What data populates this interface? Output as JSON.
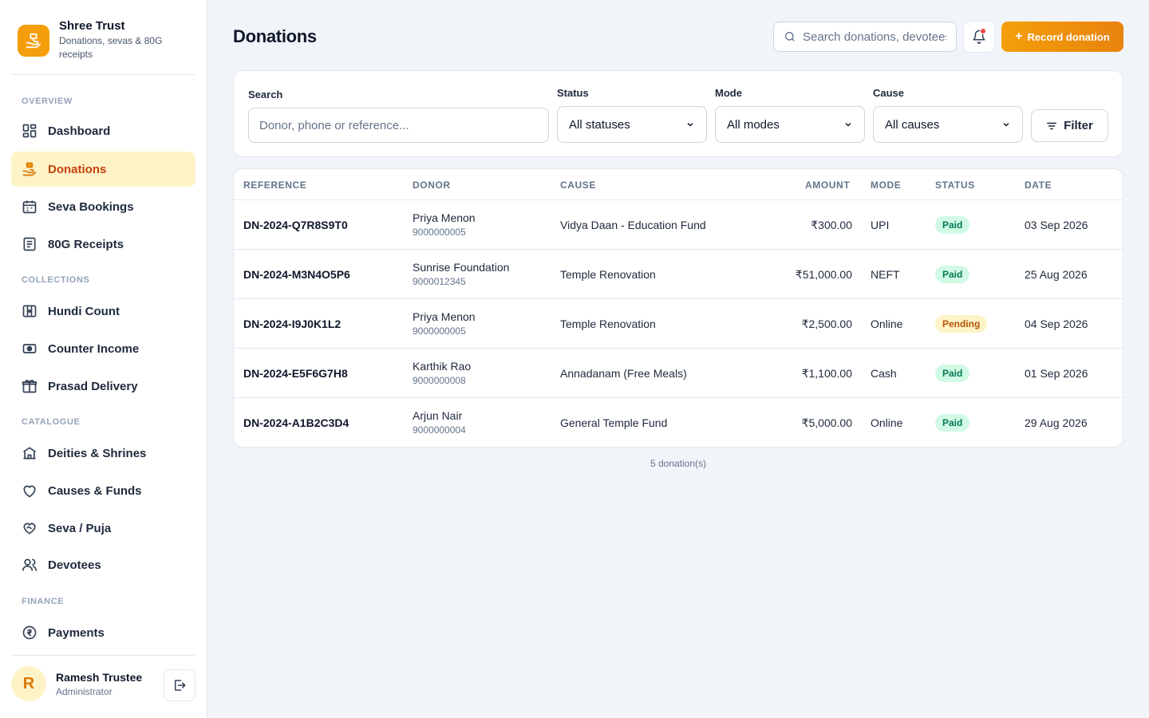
{
  "brand": {
    "name": "Shree Trust",
    "subtitle": "Donations, sevas & 80G receipts"
  },
  "sections": {
    "overview": "OVERVIEW",
    "collections": "COLLECTIONS",
    "catalogue": "CATALOGUE",
    "finance": "FINANCE"
  },
  "nav": {
    "dashboard": "Dashboard",
    "donations": "Donations",
    "seva_bookings": "Seva Bookings",
    "receipts": "80G Receipts",
    "hundi": "Hundi Count",
    "counter": "Counter Income",
    "prasad": "Prasad Delivery",
    "deities": "Deities & Shrines",
    "causes": "Causes & Funds",
    "seva_puja": "Seva / Puja",
    "devotees": "Devotees",
    "payments": "Payments"
  },
  "user": {
    "initial": "R",
    "name": "Ramesh Trustee",
    "role": "Administrator"
  },
  "header": {
    "title": "Donations",
    "search_placeholder": "Search donations, devotees...",
    "record_label": "Record donation"
  },
  "filters": {
    "search_label": "Search",
    "search_placeholder": "Donor, phone or reference...",
    "status_label": "Status",
    "status_value": "All statuses",
    "mode_label": "Mode",
    "mode_value": "All modes",
    "cause_label": "Cause",
    "cause_value": "All causes",
    "filter_button": "Filter"
  },
  "table": {
    "headers": {
      "reference": "REFERENCE",
      "donor": "DONOR",
      "cause": "CAUSE",
      "amount": "AMOUNT",
      "mode": "MODE",
      "status": "STATUS",
      "date": "DATE"
    },
    "rows": [
      {
        "reference": "DN-2024-Q7R8S9T0",
        "donor": "Priya Menon",
        "phone": "9000000005",
        "cause": "Vidya Daan - Education Fund",
        "amount": "₹300.00",
        "mode": "UPI",
        "status": "Paid",
        "date": "03 Sep 2026"
      },
      {
        "reference": "DN-2024-M3N4O5P6",
        "donor": "Sunrise Foundation",
        "phone": "9000012345",
        "cause": "Temple Renovation",
        "amount": "₹51,000.00",
        "mode": "NEFT",
        "status": "Paid",
        "date": "25 Aug 2026"
      },
      {
        "reference": "DN-2024-I9J0K1L2",
        "donor": "Priya Menon",
        "phone": "9000000005",
        "cause": "Temple Renovation",
        "amount": "₹2,500.00",
        "mode": "Online",
        "status": "Pending",
        "date": "04 Sep 2026"
      },
      {
        "reference": "DN-2024-E5F6G7H8",
        "donor": "Karthik Rao",
        "phone": "9000000008",
        "cause": "Annadanam (Free Meals)",
        "amount": "₹1,100.00",
        "mode": "Cash",
        "status": "Paid",
        "date": "01 Sep 2026"
      },
      {
        "reference": "DN-2024-A1B2C3D4",
        "donor": "Arjun Nair",
        "phone": "9000000004",
        "cause": "General Temple Fund",
        "amount": "₹5,000.00",
        "mode": "Online",
        "status": "Paid",
        "date": "29 Aug 2026"
      }
    ]
  },
  "footer": {
    "count": "5 donation(s)"
  },
  "colors": {
    "accent": "#f59e0b",
    "active_bg": "#fef3c7",
    "active_text": "#c2410c",
    "paid_bg": "#d1fae5",
    "paid_text": "#047857",
    "pending_bg": "#fef3c7",
    "pending_text": "#b45309"
  }
}
